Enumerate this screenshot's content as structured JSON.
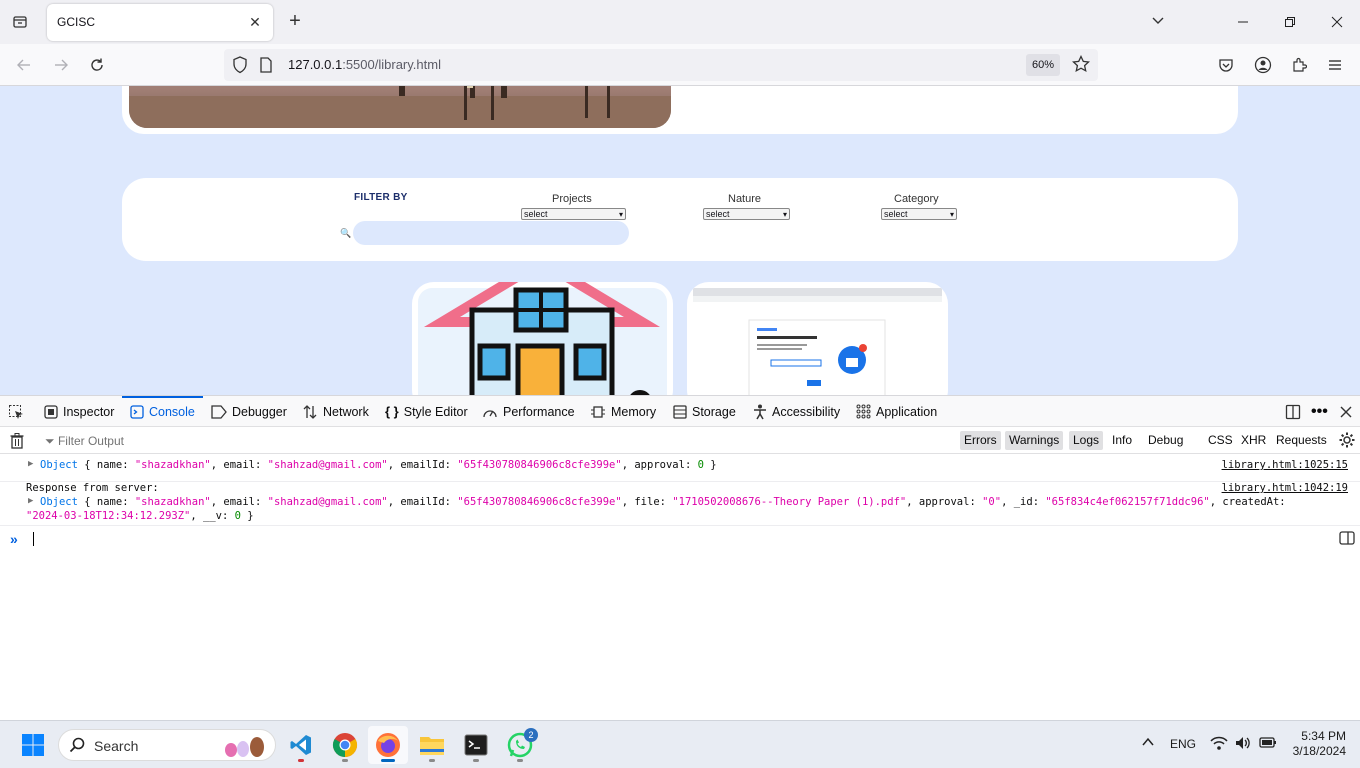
{
  "browser": {
    "tab_title": "GCISC",
    "url_host": "127.0.0.1",
    "url_rest": ":5500/library.html",
    "zoom": "60%"
  },
  "page": {
    "filter_by": "FILTER BY",
    "filters": [
      {
        "label": "Projects",
        "value": "select"
      },
      {
        "label": "Nature",
        "value": "select"
      },
      {
        "label": "Category",
        "value": "select"
      }
    ]
  },
  "devtools": {
    "tabs": [
      "Inspector",
      "Console",
      "Debugger",
      "Network",
      "Style Editor",
      "Performance",
      "Memory",
      "Storage",
      "Accessibility",
      "Application"
    ],
    "active_tab": "Console",
    "filter_placeholder": "Filter Output",
    "levels": [
      "Errors",
      "Warnings",
      "Logs",
      "Info",
      "Debug"
    ],
    "extra_filters": [
      "CSS",
      "XHR",
      "Requests"
    ],
    "messages": [
      {
        "source": "library.html:1025:15",
        "object": {
          "name": "\"shazadkhan\"",
          "email": "\"shahzad@gmail.com\"",
          "emailId": "\"65f430780846906c8cfe399e\"",
          "approval": "0"
        }
      },
      {
        "label": "Response from server:",
        "source": "library.html:1042:19",
        "object": {
          "name": "\"shazadkhan\"",
          "email": "\"shahzad@gmail.com\"",
          "emailId": "\"65f430780846906c8cfe399e\"",
          "file": "\"1710502008676--Theory Paper (1).pdf\"",
          "approval": "\"0\"",
          "_id": "\"65f834c4ef062157f71ddc96\"",
          "createdAt_label": "createdAt:",
          "createdAt": "\"2024-03-18T12:34:12.293Z\"",
          "__v": "0"
        }
      }
    ]
  },
  "taskbar": {
    "search_label": "Search",
    "language": "ENG",
    "time": "5:34 PM",
    "date": "3/18/2024",
    "whatsapp_badge": "2"
  }
}
